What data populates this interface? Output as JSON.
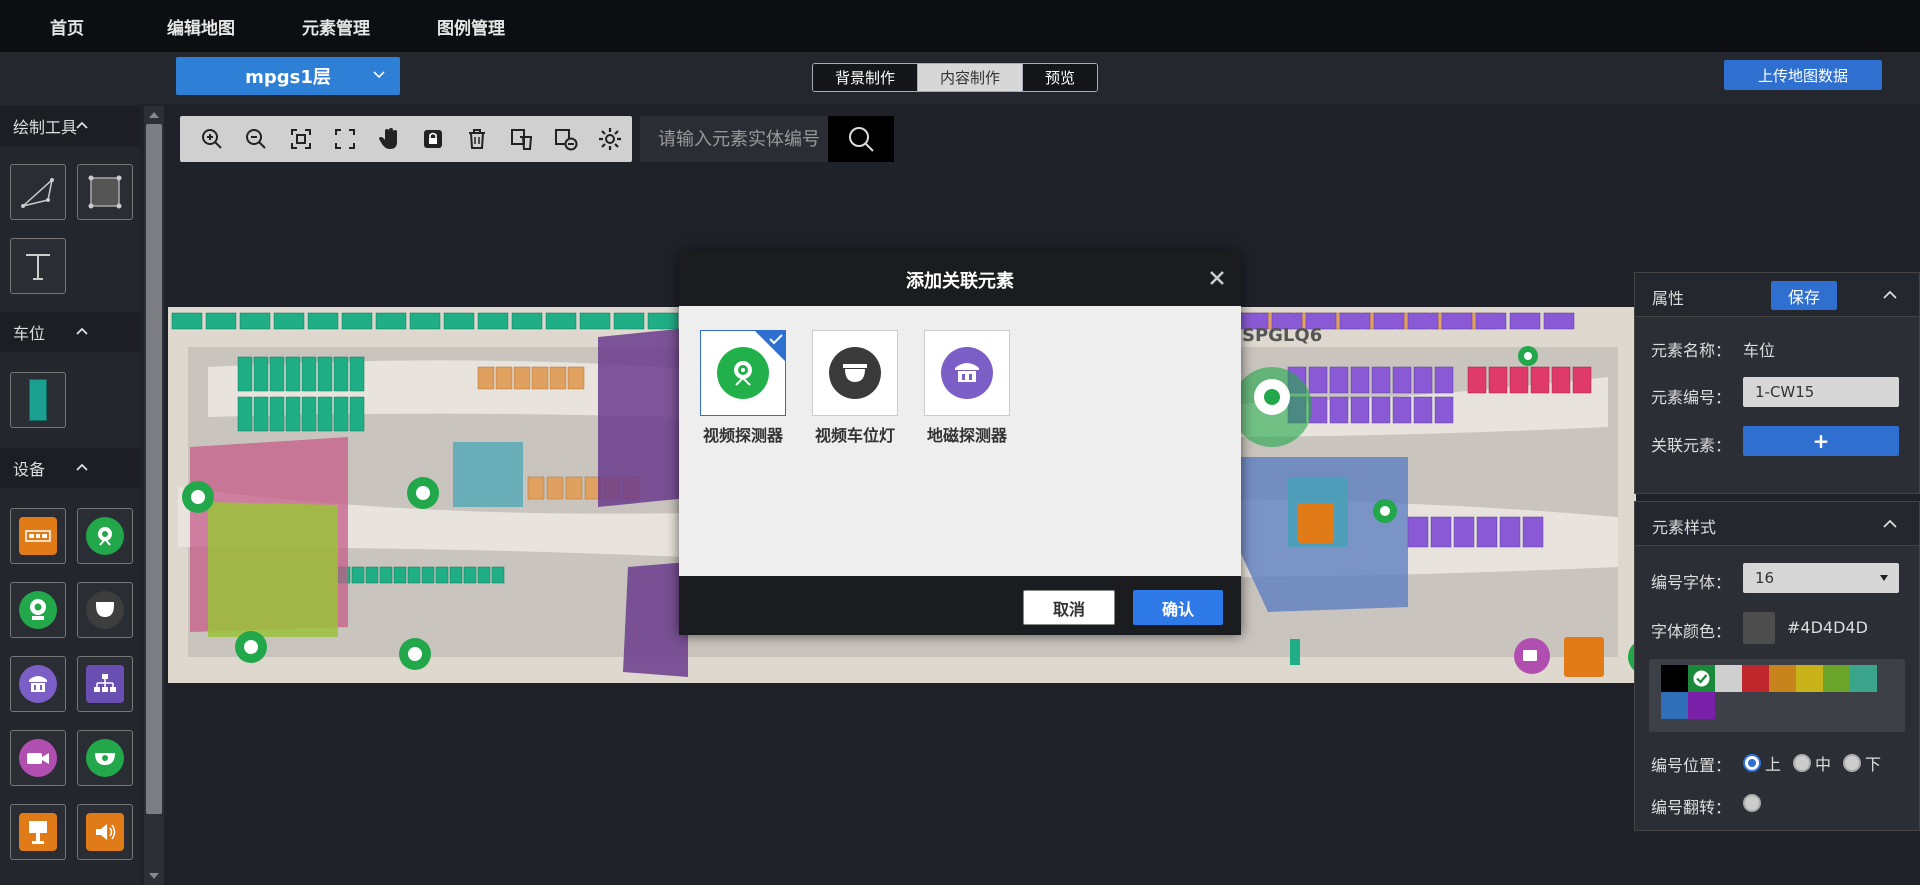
{
  "nav": {
    "items": [
      "首页",
      "编辑地图",
      "元素管理",
      "图例管理"
    ]
  },
  "subbar": {
    "floor": "mpgs1层",
    "tabs": [
      "背景制作",
      "内容制作",
      "预览"
    ],
    "active_tab": "内容制作",
    "upload_label": "上传地图数据"
  },
  "left_panel": {
    "sections": [
      {
        "title": "绘制工具",
        "tools": [
          "polyline-tool",
          "rectangle-tool",
          "text-tool"
        ]
      },
      {
        "title": "车位",
        "tools": [
          "parking-space"
        ]
      },
      {
        "title": "设备",
        "tools": [
          "barrier-gate",
          "video-detector",
          "camera-detector",
          "parking-light",
          "geomagnetic-detector",
          "network-device",
          "camera-purple",
          "dome-camera",
          "guidance-screen",
          "speaker"
        ]
      }
    ]
  },
  "search": {
    "placeholder": "请输入元素实体编号"
  },
  "map": {
    "label": "SPGLQ6"
  },
  "modal": {
    "title": "添加关联元素",
    "elements": [
      {
        "label": "视频探测器",
        "selected": true
      },
      {
        "label": "视频车位灯",
        "selected": false
      },
      {
        "label": "地磁探测器",
        "selected": false
      }
    ],
    "cancel": "取消",
    "confirm": "确认"
  },
  "properties": {
    "title": "属性",
    "save": "保存",
    "name_label": "元素名称：",
    "name_value": "车位",
    "code_label": "元素编号：",
    "code_value": "1-CW15",
    "link_label": "关联元素：",
    "link_btn": "+"
  },
  "style": {
    "title": "元素样式",
    "font_label": "编号字体：",
    "font_value": "16",
    "color_label": "字体颜色：",
    "color_value": "#4D4D4D",
    "palette": [
      "#000000",
      "#1a8a3a",
      "#cfcfcf",
      "#c0272d",
      "#c7841d",
      "#c9b31b",
      "#6aa52a",
      "#3aa58a",
      "#2f6fb8",
      "#7a1fa8"
    ],
    "position_label": "编号位置：",
    "positions": [
      "上",
      "中",
      "下"
    ],
    "position_selected": "上",
    "flip_label": "编号翻转："
  }
}
